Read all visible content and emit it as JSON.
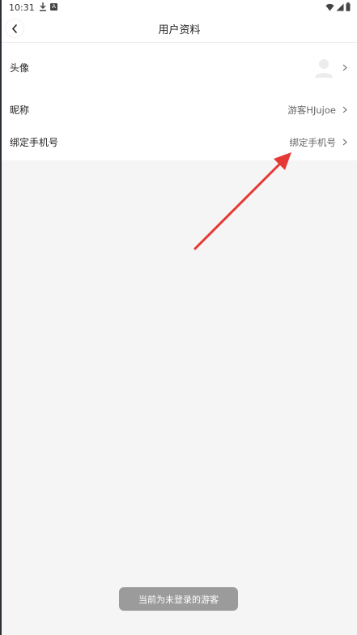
{
  "status_bar": {
    "time": "10:31",
    "icons": [
      "download-icon",
      "a-notification-icon",
      "wifi-icon",
      "signal-icon",
      "battery-icon"
    ],
    "a_badge": "A"
  },
  "header": {
    "title": "用户资料",
    "back_icon": "chevron-left-icon"
  },
  "profile": {
    "avatar_label": "头像",
    "nickname_label": "昵称",
    "nickname_value": "游客HJujoe",
    "phone_label": "绑定手机号",
    "phone_value": "绑定手机号"
  },
  "toast": {
    "text": "当前为未登录的游客"
  },
  "colors": {
    "background": "#f5f5f5",
    "surface": "#ffffff",
    "annotation_arrow": "#e53935",
    "toast_bg": "#9b9b9b"
  }
}
